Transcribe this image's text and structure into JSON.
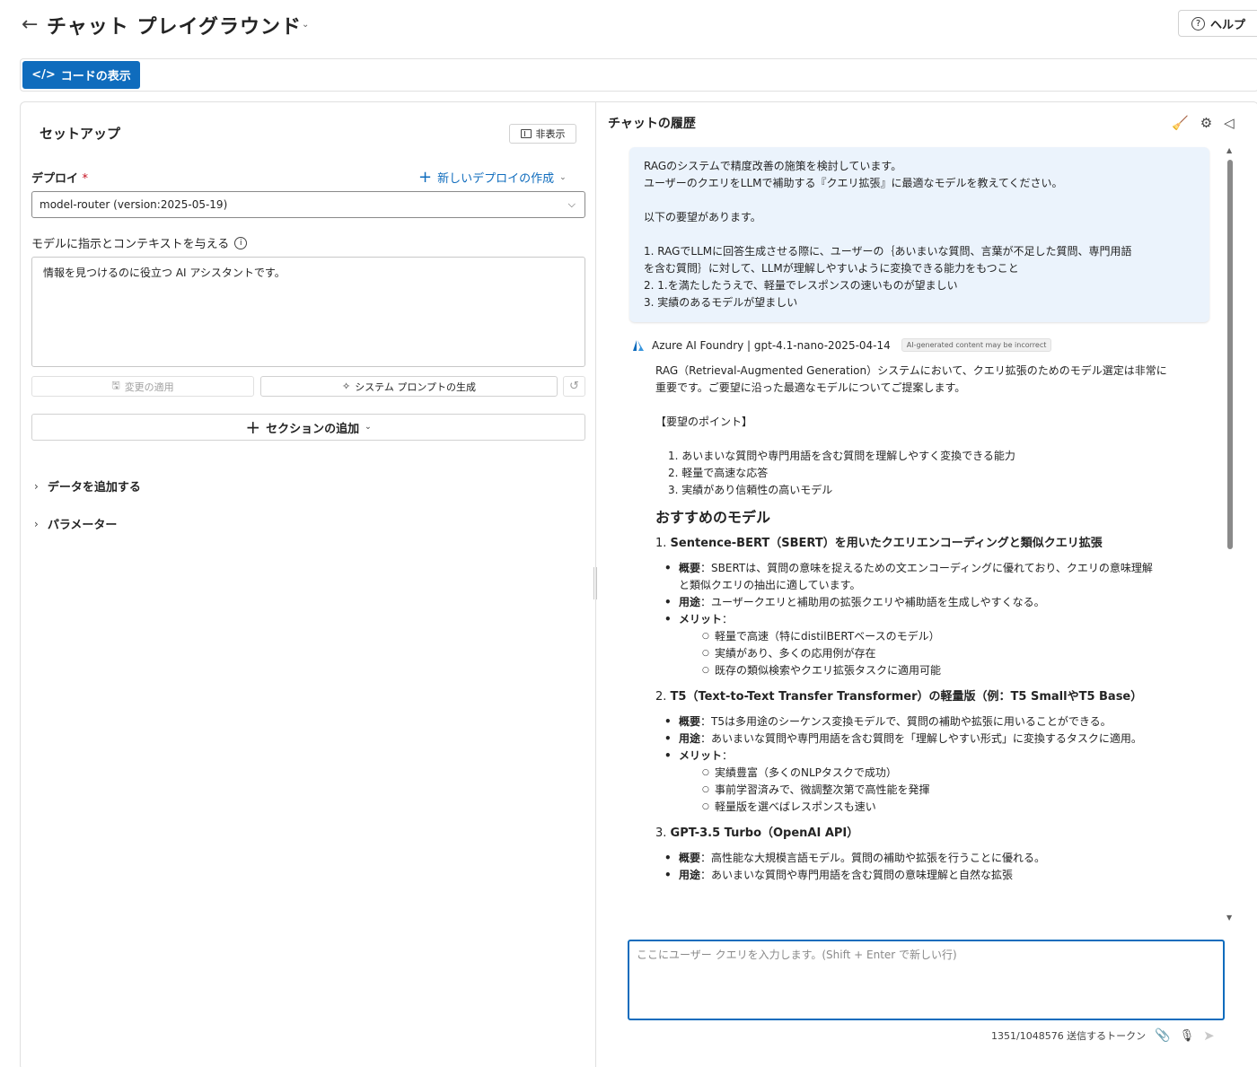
{
  "header": {
    "back_icon": "←",
    "title": "チャット プレイグラウンド",
    "help_label": "ヘルプ"
  },
  "toolbar": {
    "code_label": "コードの表示"
  },
  "setup": {
    "title": "セットアップ",
    "hide_label": "非表示",
    "deploy_label": "デプロイ",
    "required_mark": "*",
    "new_deploy_label": "新しいデプロイの作成",
    "deploy_value": "model-router (version:2025-05-19)",
    "instructions_label": "モデルに指示とコンテキストを与える",
    "instructions_value": "情報を見つけるのに役立つ AI アシスタントです。",
    "apply_label": "変更の適用",
    "generate_label": "システム プロンプトの生成",
    "add_section_label": "セクションの追加",
    "add_data_label": "データを追加する",
    "parameters_label": "パラメーター"
  },
  "chat": {
    "title": "チャットの履歴",
    "user_message": [
      "RAGのシステムで精度改善の施策を検討しています。",
      "ユーザーのクエリをLLMで補助する『クエリ拡張』に最適なモデルを教えてください。",
      "",
      "以下の要望があります。",
      "",
      "1. RAGでLLMに回答生成させる際に、ユーザーの｛あいまいな質問、言葉が不足した質問、専門用語",
      "を含む質問｝に対して、LLMが理解しやすいように変換できる能力をもつこと",
      "2. 1.を満たしたうえで、軽量でレスポンスの速いものが望ましい",
      "3. 実績のあるモデルが望ましい"
    ],
    "bot_name": "Azure AI Foundry | gpt-4.1-nano-2025-04-14",
    "ai_badge": "AI-generated content may be incorrect",
    "bot_intro_1": "RAG（Retrieval-Augmented Generation）システムにおいて、クエリ拡張のためのモデル選定は非常に",
    "bot_intro_2": "重要です。ご要望に沿った最適なモデルについてご提案します。",
    "points_heading": "【要望のポイント】",
    "points": [
      "1. あいまいな質問や専門用語を含む質問を理解しやすく変換できる能力",
      "2. 軽量で高速な応答",
      "3. 実績があり信頼性の高いモデル"
    ],
    "recommend_heading": "おすすめのモデル",
    "m1_num": "1. ",
    "m1_title": "Sentence-BERT（SBERT）を用いたクエリエンコーディングと類似クエリ拡張",
    "m1_overview_key": "概要",
    "m1_overview_1": "：SBERTは、質問の意味を捉えるための文エンコーディングに優れており、クエリの意味理解",
    "m1_overview_2": "と類似クエリの抽出に適しています。",
    "m1_use_key": "用途",
    "m1_use": "：ユーザークエリと補助用の拡張クエリや補助語を生成しやすくなる。",
    "merit_key": "メリット",
    "merit_colon": "：",
    "m1_merits": [
      "軽量で高速（特にdistilBERTベースのモデル）",
      "実績があり、多くの応用例が存在",
      "既存の類似検索やクエリ拡張タスクに適用可能"
    ],
    "m2_num": "2. ",
    "m2_title": "T5（Text-to-Text Transfer Transformer）の軽量版（例：T5 SmallやT5 Base）",
    "m2_overview_key": "概要",
    "m2_overview": "：T5は多用途のシーケンス変換モデルで、質問の補助や拡張に用いることができる。",
    "m2_use_key": "用途",
    "m2_use": "：あいまいな質問や専門用語を含む質問を「理解しやすい形式」に変換するタスクに適用。",
    "m2_merits": [
      "実績豊富（多くのNLPタスクで成功）",
      "事前学習済みで、微調整次第で高性能を発揮",
      "軽量版を選べばレスポンスも速い"
    ],
    "m3_num": "3. ",
    "m3_title": "GPT-3.5 Turbo（OpenAI API）",
    "m3_overview_key": "概要",
    "m3_overview": "：高性能な大規模言語モデル。質問の補助や拡張を行うことに優れる。",
    "m3_use_key": "用途",
    "m3_use": "：あいまいな質問や専門用語を含む質問の意味理解と自然な拡張",
    "input_placeholder": "ここにユーザー クエリを入力します。(Shift + Enter で新しい行)",
    "token_count": "1351/1048576 送信するトークン"
  },
  "colors": {
    "accent": "#0f6cbd",
    "user_bubble": "#ebf3fc"
  }
}
